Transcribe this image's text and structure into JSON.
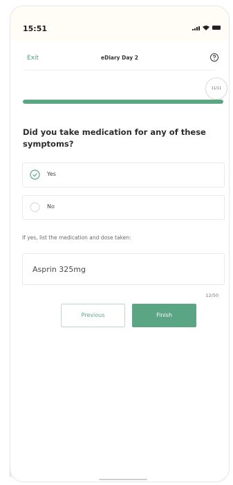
{
  "status_bar": {
    "time": "15:51"
  },
  "nav": {
    "exit_label": "Exit",
    "title": "eDiary Day 2",
    "help_icon": "question-circle-icon"
  },
  "progress": {
    "label": "11/11",
    "fraction": 1.0,
    "color": "#5aa583"
  },
  "question": {
    "text": "Did you take medication for any of these symptoms?",
    "options": [
      {
        "label": "Yes",
        "selected": true
      },
      {
        "label": "No",
        "selected": false
      }
    ]
  },
  "medication_field": {
    "label": "If yes, list the medication and dose taken:",
    "value": "Asprin 325mg",
    "char_count": "12/50"
  },
  "buttons": {
    "previous_label": "Previous",
    "finish_label": "Finish"
  },
  "colors": {
    "accent": "#5aa583",
    "accent_light": "#b9d8c8"
  }
}
